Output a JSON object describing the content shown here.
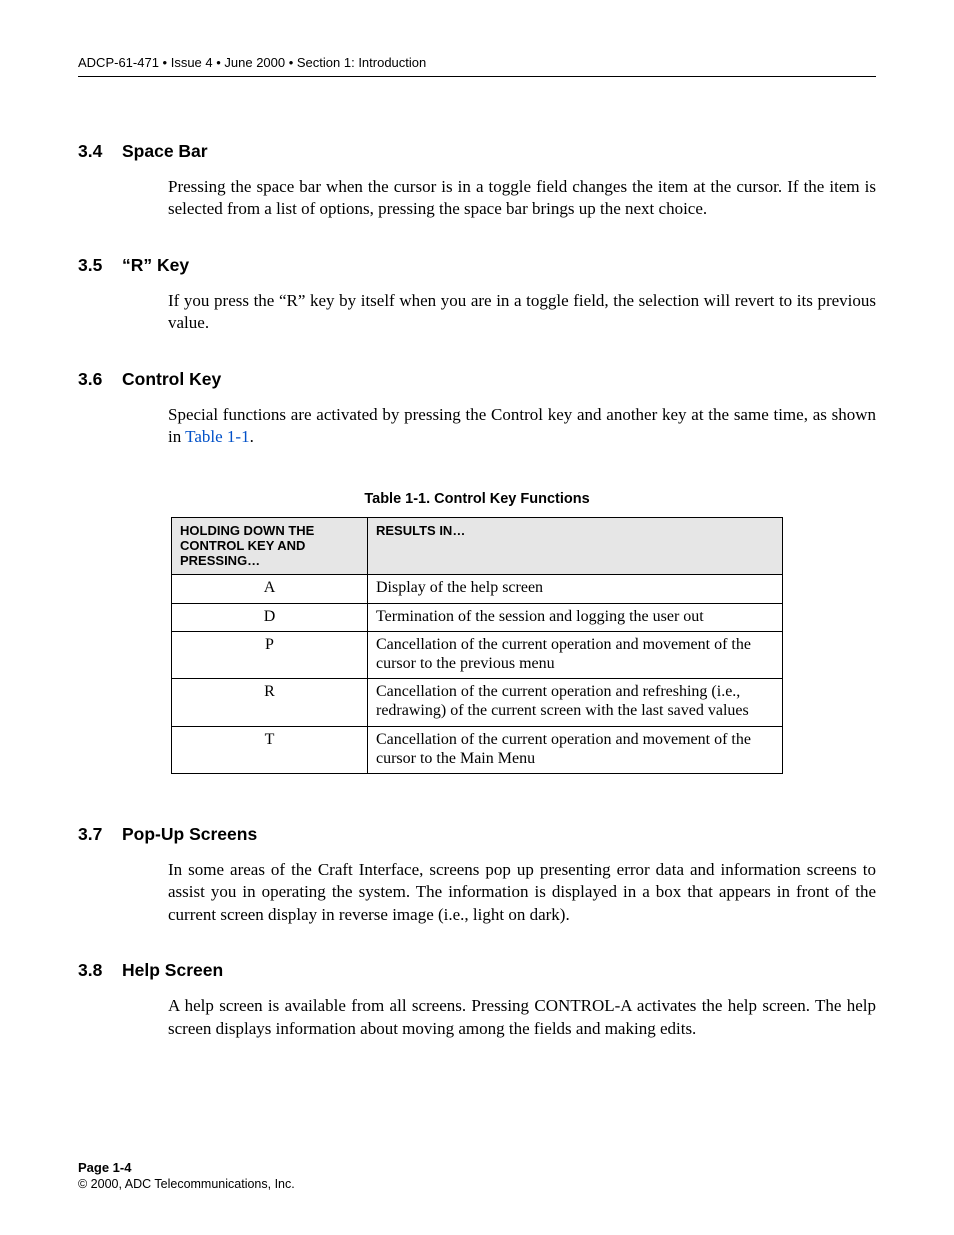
{
  "header": "ADCP-61-471 • Issue 4 • June 2000 • Section 1: Introduction",
  "sections": [
    {
      "num": "3.4",
      "title": "Space Bar",
      "paras": [
        "Pressing the space bar when the cursor is in a toggle field changes the item at the cursor. If the item is selected from a list of options, pressing the space bar brings up the next choice."
      ]
    },
    {
      "num": "3.5",
      "title": "“R” Key",
      "paras": [
        "If you press the “R” key by itself when you are in a toggle field,  the selection will revert to its previous value."
      ]
    },
    {
      "num": "3.6",
      "title": "Control Key",
      "paras_pre": "Special functions are activated by pressing the Control key and another key at the same time, as shown in ",
      "link_text": "Table 1-1",
      "paras_post": "."
    },
    {
      "num": "3.7",
      "title": "Pop-Up Screens",
      "paras": [
        "In some areas of the Craft Interface, screens pop up presenting error data and information screens to assist you in operating the system. The information is displayed in a box that appears in front of the current screen display in reverse image (i.e., light on dark)."
      ]
    },
    {
      "num": "3.8",
      "title": "Help Screen",
      "paras": [
        "A help screen is available from all screens. Pressing CONTROL-A activates the help screen. The help screen displays information about moving among the fields and making edits."
      ]
    }
  ],
  "table": {
    "caption": "Table 1-1. Control Key Functions",
    "headers": [
      "HOLDING DOWN THE CONTROL KEY AND PRESSING…",
      "RESULTS IN…"
    ],
    "rows": [
      {
        "key": "A",
        "result": "Display of the help screen"
      },
      {
        "key": "D",
        "result": "Termination of the session and logging the user out"
      },
      {
        "key": "P",
        "result": "Cancellation of the current operation and movement of the cursor to the previous menu"
      },
      {
        "key": "R",
        "result": "Cancellation of the current operation and refreshing (i.e., redrawing) of the current screen with the last saved values"
      },
      {
        "key": "T",
        "result": "Cancellation of the current operation and movement of the cursor to the Main Menu"
      }
    ]
  },
  "footer": {
    "page": "Page 1-4",
    "copyright": "© 2000, ADC Telecommunications, Inc."
  }
}
